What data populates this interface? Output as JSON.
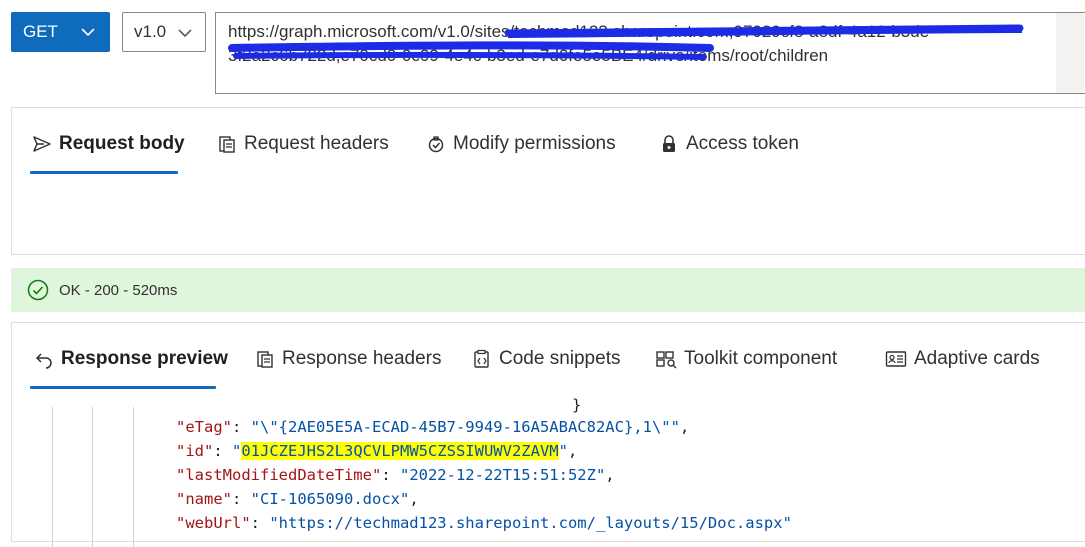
{
  "toolbar": {
    "method": "GET",
    "version": "v1.0",
    "url_line1": "https://graph.microsoft.com/v1.0/sites/techmad123.sharepoint.com,97029cf8-a8df-4a12-b3de",
    "url_line2": "3f2a2c6b722d,e70cd0-0c09-4e4c-b3ed-e7d0fe5e5BE4/drive/items/root/children"
  },
  "request_tabs": [
    "Request body",
    "Request headers",
    "Modify permissions",
    "Access token"
  ],
  "status": {
    "text": "OK - 200 - 520ms",
    "color": "#dff6dd"
  },
  "response_tabs": [
    "Response preview",
    "Response headers",
    "Code snippets",
    "Toolkit component",
    "Adaptive cards"
  ],
  "code": {
    "line1": {
      "key": "\"eTag\"",
      "value": "\"\\\"{2AE05E5A-ECAD-45B7-9949-16A5ABAC82AC},1\\\"\""
    },
    "line2": {
      "key": "\"id\"",
      "value_open": "\"",
      "value": "01JCZEJHS2L3QCVLPMW5CZSSIWUWV2ZAVM",
      "value_close": "\""
    },
    "line3": {
      "key": "\"lastModifiedDateTime\"",
      "value": "\"2022-12-22T15:51:52Z\""
    },
    "line4": {
      "key": "\"name\"",
      "value": "\"CI-1065090.docx\""
    },
    "line5": {
      "key": "\"webUrl\"",
      "value": "\"https://techmad123.sharepoint.com/_layouts/15/Doc.aspx\""
    }
  },
  "colors": {
    "accent": "#0f6cbd",
    "highlight": "#ffff00",
    "success": "#107c10"
  },
  "icons": [
    "chevron-down-icon",
    "send-icon",
    "headers-icon",
    "permissions-icon",
    "lock-icon",
    "success-check-icon",
    "back-arrow-icon",
    "code-snippet-icon",
    "toolkit-icon",
    "adaptive-card-icon"
  ]
}
